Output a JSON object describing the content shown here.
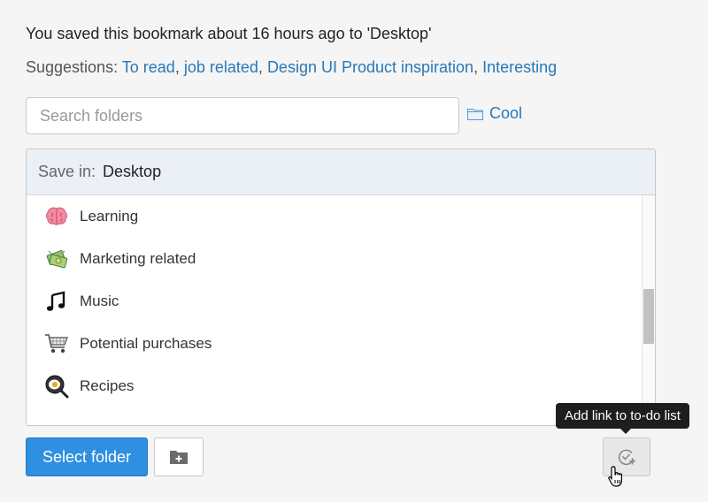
{
  "status": {
    "saved_message": "You saved this bookmark about 16 hours ago to 'Desktop'"
  },
  "suggestions": {
    "label": "Suggestions:",
    "items": [
      "To read",
      "job related",
      "Design UI Product inspiration",
      "Interesting"
    ],
    "separator": ","
  },
  "search": {
    "placeholder": "Search folders",
    "value": ""
  },
  "quick_folder": {
    "label": "Cool",
    "icon": "folder-icon"
  },
  "save_panel": {
    "label": "Save in:",
    "value": "Desktop",
    "folders": [
      {
        "label": "Learning",
        "icon": "brain-icon"
      },
      {
        "label": "Marketing related",
        "icon": "money-icon"
      },
      {
        "label": "Music",
        "icon": "music-note-icon"
      },
      {
        "label": "Potential purchases",
        "icon": "shopping-cart-icon"
      },
      {
        "label": "Recipes",
        "icon": "frying-pan-egg-icon"
      }
    ]
  },
  "actions": {
    "select_folder_label": "Select folder",
    "new_folder_icon": "new-folder-icon",
    "todo_icon": "check-circle-plus-icon",
    "todo_tooltip": "Add link to to-do list"
  },
  "colors": {
    "link": "#2878b8",
    "primary_button": "#2f8fe0",
    "header_bg": "#eaf0f6",
    "tooltip_bg": "#1e1e1e"
  }
}
